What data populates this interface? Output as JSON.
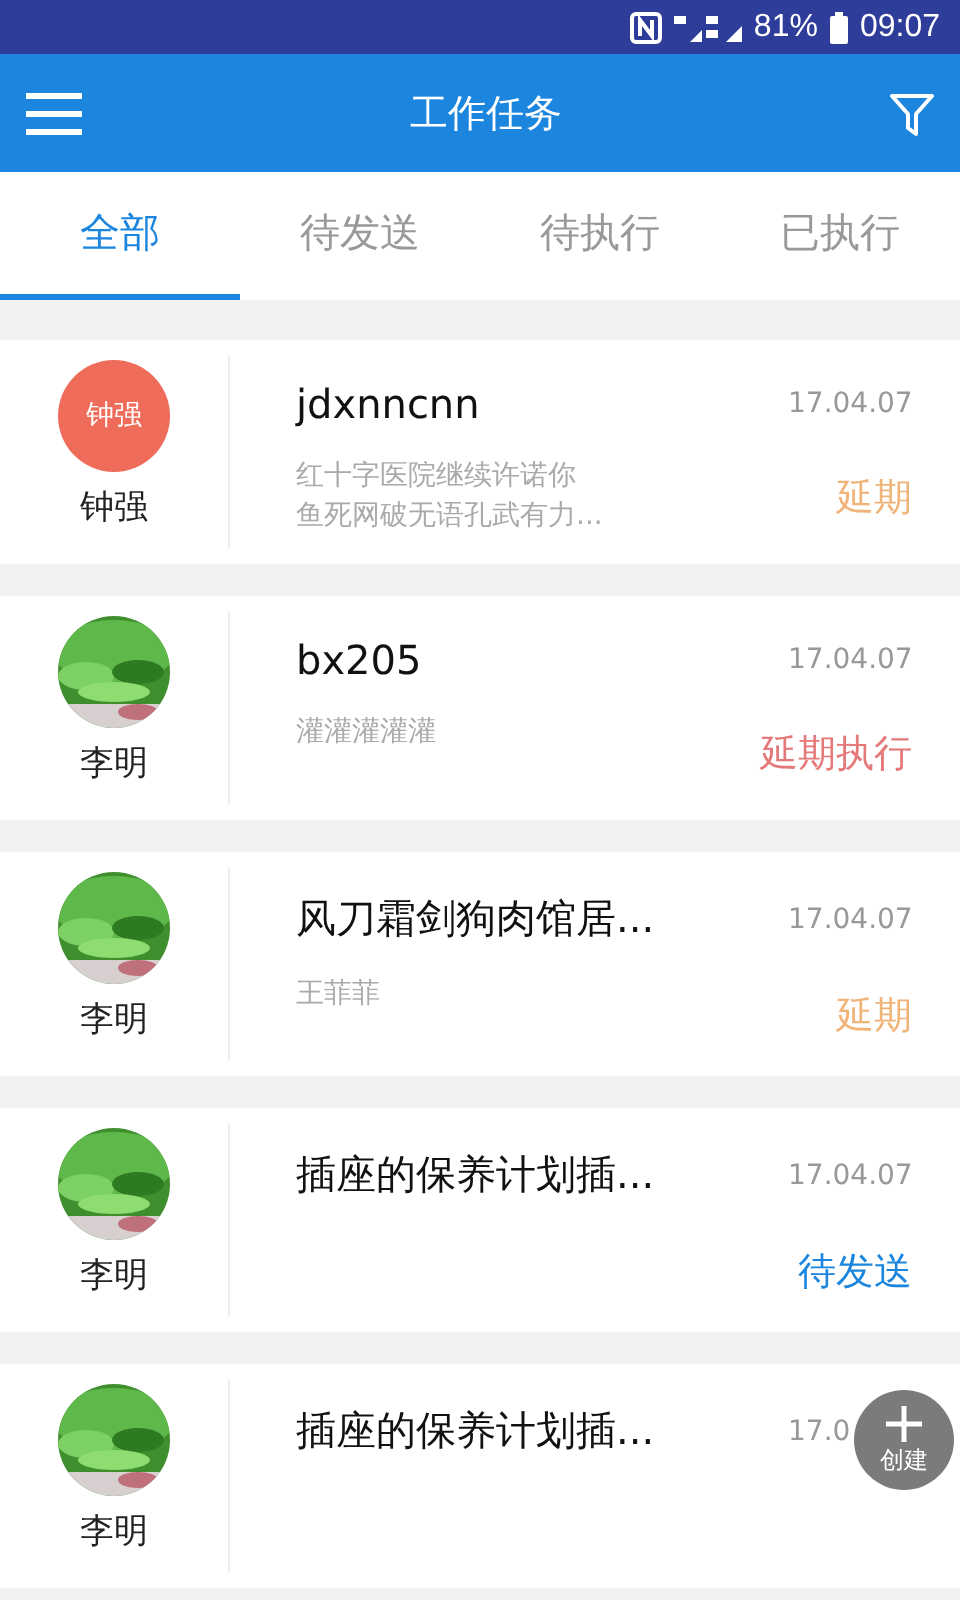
{
  "status_bar": {
    "battery_text": "81%",
    "time": "09:07"
  },
  "app_bar": {
    "title": "工作任务"
  },
  "tabs": [
    {
      "label": "全部",
      "selected": true
    },
    {
      "label": "待发送",
      "selected": false
    },
    {
      "label": "待执行",
      "selected": false
    },
    {
      "label": "已执行",
      "selected": false
    }
  ],
  "tasks": [
    {
      "avatar": {
        "kind": "initials",
        "text": "钟强"
      },
      "person": "钟强",
      "title": "jdxnncnn",
      "date": "17.04.07",
      "description": [
        "红十字医院继续许诺你",
        "鱼死网破无语孔武有力..."
      ],
      "status": {
        "kind": "postponed",
        "text": "延期"
      }
    },
    {
      "avatar": {
        "kind": "picture"
      },
      "person": "李明",
      "title": "bx205",
      "date": "17.04.07",
      "description": [
        "灌灌灌灌灌"
      ],
      "status": {
        "kind": "postponed_exec",
        "text": "延期执行"
      }
    },
    {
      "avatar": {
        "kind": "picture"
      },
      "person": "李明",
      "title": "风刀霜剑狗肉馆居...",
      "date": "17.04.07",
      "description": [
        "王菲菲"
      ],
      "status": {
        "kind": "postponed",
        "text": "延期"
      }
    },
    {
      "avatar": {
        "kind": "picture"
      },
      "person": "李明",
      "title": "插座的保养计划插...",
      "date": "17.04.07",
      "status": {
        "kind": "pending_send",
        "text": "待发送"
      }
    },
    {
      "avatar": {
        "kind": "picture"
      },
      "person": "李明",
      "title": "插座的保养计划插...",
      "date": "17.0"
    }
  ],
  "fab": {
    "label": "创建"
  }
}
